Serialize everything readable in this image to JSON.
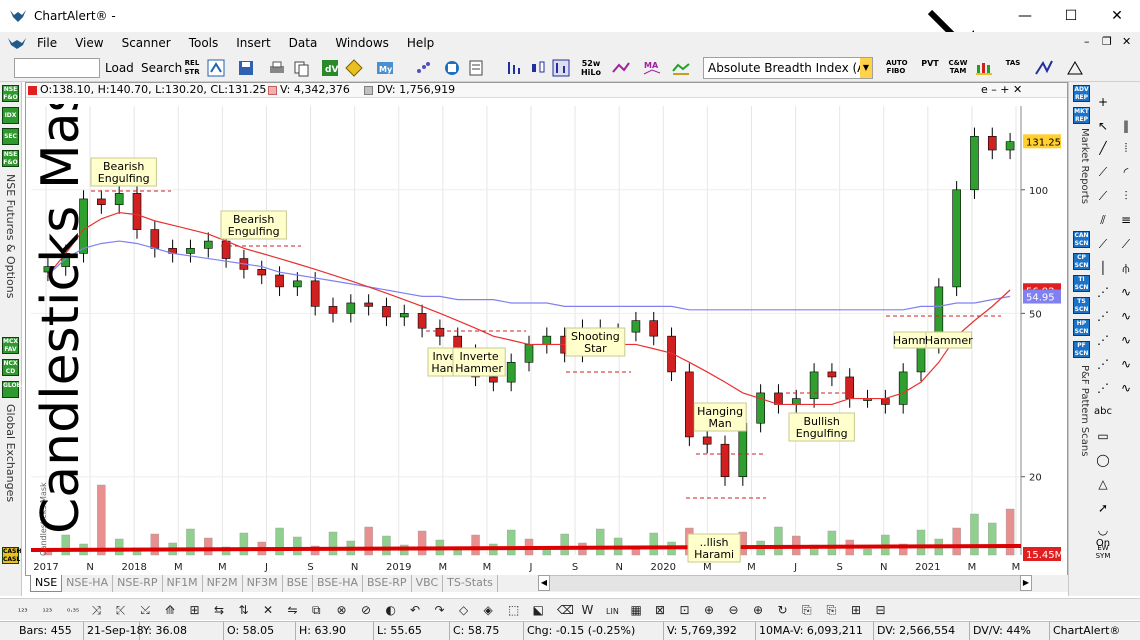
{
  "window": {
    "title": "ChartAlert® -",
    "min_glyph": "—",
    "max_glyph": "☐",
    "close_glyph": "✕"
  },
  "menu": [
    "File",
    "View",
    "Scanner",
    "Tools",
    "Insert",
    "Data",
    "Windows",
    "Help"
  ],
  "mdi": {
    "min": "–",
    "restore": "❐",
    "close": "✕"
  },
  "toolbar": {
    "load_label": "Load",
    "search_label": "Search",
    "rel_str": "REL STR",
    "week52": "52w HiLo",
    "indicator_combo": "Absolute Breadth Index (AB",
    "icons": {
      "auto_fibo": "AUTO FIBO",
      "pvt": "PVT",
      "cw_tam": "C&W TAM",
      "tas": "TAS"
    }
  },
  "chart": {
    "info": {
      "ohlc": "O:138.10, H:140.70, L:130.20, CL:131.25",
      "volume": "V: 4,342,376",
      "dv": "DV: 1,756,919",
      "controls": "e  –  +  ✕"
    },
    "price_label": "131.25",
    "ma_label1": "56.92",
    "ma_label2": "54.95",
    "vol_label": "15.45M",
    "y_ticks": [
      "100",
      "50",
      "20"
    ],
    "x_ticks": [
      "2017",
      "N",
      "2018",
      "M",
      "M",
      "J",
      "S",
      "N",
      "2019",
      "M",
      "M",
      "J",
      "S",
      "N",
      "2020",
      "M",
      "M",
      "J",
      "S",
      "N",
      "2021",
      "M",
      "M"
    ],
    "watermark": "Candlesticks Mask",
    "small_vertical_text": "Candlesticks Mask",
    "annotations": [
      {
        "text": "Bearish\nEngulfing"
      },
      {
        "text": "Bearish\nEngulfing"
      },
      {
        "text": "Inve\nHam"
      },
      {
        "text": "Inverte\nHammer"
      },
      {
        "text": "Shooting\nStar"
      },
      {
        "text": "Hanging\nMan"
      },
      {
        "text": "Bullish\nEngulfing"
      },
      {
        "text": "Hammer"
      },
      {
        "text": "Hammer"
      },
      {
        "text": "..llish\nHarami"
      }
    ]
  },
  "chart_data": {
    "type": "candlestick",
    "title": "",
    "xlabel": "",
    "ylabel": "",
    "scale": "log",
    "ylim": [
      15,
      160
    ],
    "x": [
      "2016-10",
      "2016-11",
      "2016-12",
      "2017-01",
      "2017-02",
      "2017-03",
      "2017-04",
      "2017-05",
      "2017-06",
      "2017-07",
      "2017-08",
      "2017-09",
      "2017-10",
      "2017-11",
      "2017-12",
      "2018-01",
      "2018-02",
      "2018-03",
      "2018-04",
      "2018-05",
      "2018-06",
      "2018-07",
      "2018-08",
      "2018-09",
      "2018-10",
      "2018-11",
      "2018-12",
      "2019-01",
      "2019-02",
      "2019-03",
      "2019-04",
      "2019-05",
      "2019-06",
      "2019-07",
      "2019-08",
      "2019-09",
      "2019-10",
      "2019-11",
      "2019-12",
      "2020-01",
      "2020-02",
      "2020-03",
      "2020-04",
      "2020-05",
      "2020-06",
      "2020-07",
      "2020-08",
      "2020-09",
      "2020-10",
      "2020-11",
      "2020-12",
      "2021-01",
      "2021-02",
      "2021-03",
      "2021-04"
    ],
    "close": [
      65,
      70,
      95,
      92,
      98,
      80,
      72,
      70,
      72,
      75,
      68,
      64,
      62,
      58,
      60,
      52,
      50,
      53,
      52,
      49,
      50,
      46,
      44,
      40,
      35,
      34,
      38,
      42,
      44,
      40,
      46,
      42,
      45,
      48,
      44,
      36,
      25,
      24,
      20,
      27,
      32,
      30,
      31,
      36,
      35,
      31,
      31,
      30,
      36,
      42,
      58,
      100,
      135,
      125,
      131
    ],
    "series": [
      {
        "name": "",
        "values": [
          62,
          68,
          72,
          74,
          75,
          74,
          72,
          70,
          69,
          68,
          67,
          66,
          65,
          63,
          62,
          61,
          60,
          59,
          58,
          57,
          56,
          55,
          55,
          54,
          54,
          54,
          53,
          53,
          53,
          52,
          52,
          52,
          52,
          52,
          52,
          52,
          51,
          51,
          51,
          51,
          51,
          51,
          51,
          51,
          51,
          51,
          51,
          51,
          51,
          52,
          52,
          53,
          53,
          54,
          55
        ]
      },
      {
        "name": "",
        "values": [
          62,
          70,
          80,
          85,
          88,
          87,
          84,
          82,
          80,
          78,
          75,
          72,
          70,
          68,
          66,
          64,
          62,
          60,
          58,
          56,
          54,
          52,
          50,
          48,
          46,
          44,
          43,
          42,
          42,
          42,
          42,
          42,
          42,
          42,
          41,
          40,
          38,
          36,
          34,
          32,
          31,
          30,
          30,
          30,
          30,
          31,
          31,
          31,
          32,
          34,
          38,
          44,
          48,
          52,
          57
        ]
      }
    ],
    "annotations": [
      "Bearish Engulfing",
      "Bearish Engulfing",
      "Inverted Hammer",
      "Inverted Hammer",
      "Shooting Star",
      "Hanging Man",
      "Hammer",
      "Bullish Engulfing",
      "Hammer",
      "Bullish Harami"
    ],
    "grid": false
  },
  "left_strip": {
    "buttons": [
      "NSE F&O",
      "IDX",
      "SEC",
      "NSE F&O",
      "MCX FAV",
      "NCX CD",
      "GLOBAL"
    ],
    "label1": "NSE Futures & Options",
    "label2": "Global Exchanges",
    "label3": "CASH CASL"
  },
  "right_panel": {
    "buttons": [
      "ADV REP",
      "MKT REP",
      "CAN SCN",
      "CP SCN",
      "TI SCN",
      "TS SCN",
      "HP SCN",
      "PF SCN"
    ],
    "label1": "Market Reports",
    "label2": "P&F Pattern Scans",
    "on_label": "On",
    "ew_label": "EW SYM"
  },
  "tabs": [
    "NSE",
    "NSE-HA",
    "NSE-RP",
    "NF1M",
    "NF2M",
    "NF3M",
    "BSE",
    "BSE-HA",
    "BSE-RP",
    "VBC",
    "TS-Stats"
  ],
  "status": {
    "bars": "Bars: 455",
    "date": "21-Sep-18",
    "y": "Y: 36.08",
    "o": "O: 58.05",
    "h": "H: 63.90",
    "l": "L: 55.65",
    "c": "C: 58.75",
    "chg": "Chg: -0.15 (-0.25%)",
    "v": "V: 5,769,392",
    "ma": "10MA-V: 6,093,211",
    "dv": "DV: 2,566,554",
    "dvv": "DV/V: 44%",
    "app": "ChartAlert®"
  },
  "colors": {
    "ma_red": "#e83030",
    "ma_blue": "#8080f0",
    "candle_green": "#2fa02f",
    "candle_red": "#d02020",
    "volume_green": "#8fd08f",
    "volume_red": "#e89090",
    "bottom_line": "#dd0000"
  }
}
